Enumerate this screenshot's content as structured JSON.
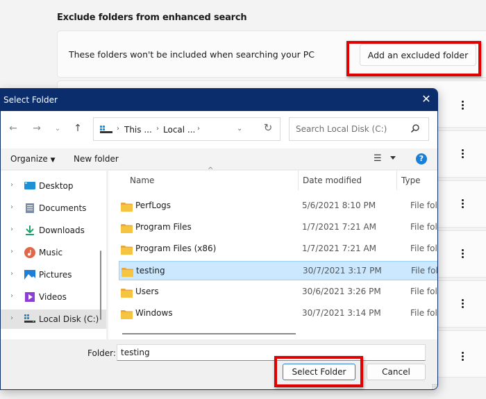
{
  "settings": {
    "section_title": "Exclude folders from enhanced search",
    "card_description": "These folders won't be included when searching your PC",
    "add_button": "Add an excluded folder",
    "more_options_icon": "kebab-vertical-icon"
  },
  "dialog": {
    "title": "Select Folder",
    "close_icon": "close-icon",
    "nav": {
      "back_icon": "arrow-left-icon",
      "forward_icon": "arrow-right-icon",
      "recent_icon": "chevron-down-icon",
      "up_icon": "arrow-up-icon",
      "breadcrumbs": [
        "This ...",
        "Local ..."
      ],
      "search_placeholder": "Search Local Disk (C:)"
    },
    "toolbar": {
      "organize": "Organize",
      "new_folder": "New folder",
      "help": "?"
    },
    "nav_pane": [
      {
        "label": "Desktop",
        "icon": "desktop-icon",
        "color": "#1e90d6"
      },
      {
        "label": "Documents",
        "icon": "documents-icon",
        "color": "#7a8ca8"
      },
      {
        "label": "Downloads",
        "icon": "downloads-icon",
        "color": "#1aa36b"
      },
      {
        "label": "Music",
        "icon": "music-icon",
        "color": "#e0674a"
      },
      {
        "label": "Pictures",
        "icon": "pictures-icon",
        "color": "#1d7fd8"
      },
      {
        "label": "Videos",
        "icon": "videos-icon",
        "color": "#8b3fd6"
      },
      {
        "label": "Local Disk (C:)",
        "icon": "local-disk-icon",
        "color": "#1e90d6",
        "selected": true
      }
    ],
    "columns": {
      "name": "Name",
      "date": "Date modified",
      "type": "Type"
    },
    "files": [
      {
        "name": "PerfLogs",
        "date": "5/6/2021 8:10 PM",
        "type": "File folder"
      },
      {
        "name": "Program Files",
        "date": "1/7/2021 7:21 AM",
        "type": "File folder"
      },
      {
        "name": "Program Files (x86)",
        "date": "1/7/2021 7:21 AM",
        "type": "File folder"
      },
      {
        "name": "testing",
        "date": "30/7/2021 3:17 PM",
        "type": "File folder",
        "selected": true
      },
      {
        "name": "Users",
        "date": "30/6/2021 3:26 PM",
        "type": "File folder"
      },
      {
        "name": "Windows",
        "date": "30/7/2021 3:14 PM",
        "type": "File folder"
      }
    ],
    "footer": {
      "folder_label": "Folder:",
      "folder_value": "testing",
      "select_button": "Select Folder",
      "cancel_button": "Cancel"
    }
  },
  "colors": {
    "titlebar": "#0b2d6b",
    "highlight": "#e00000",
    "selection": "#cce8ff",
    "folder": "#f5c542"
  }
}
